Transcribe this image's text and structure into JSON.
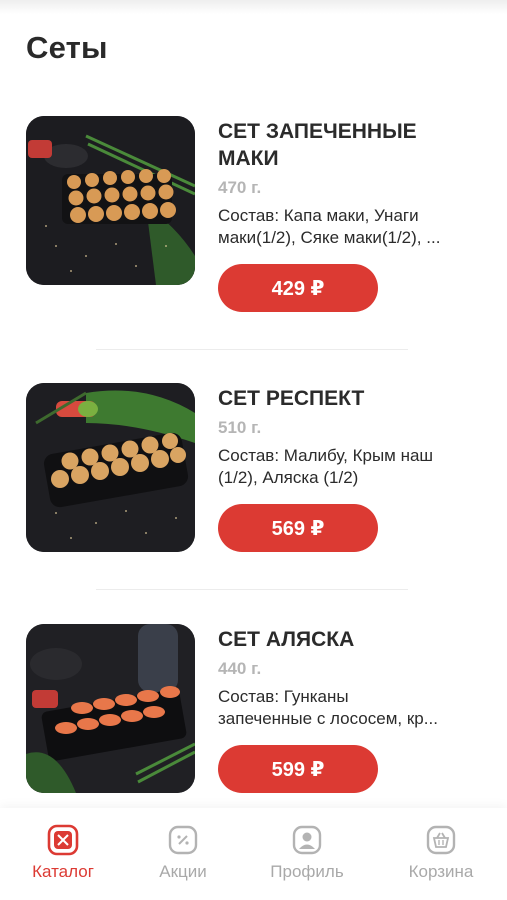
{
  "page": {
    "title": "Сеты"
  },
  "products": [
    {
      "name_line1": "СЕТ ЗАПЕЧЕННЫЕ",
      "name_line2": "МАКИ",
      "weight": "470 г.",
      "desc_line1": "Состав: Капа маки, Унаги",
      "desc_line2": "маки(1/2), Сяке маки(1/2), ...",
      "price": "429 ₽"
    },
    {
      "name_line1": "СЕТ РЕСПЕКТ",
      "name_line2": "",
      "weight": "510 г.",
      "desc_line1": "Состав: Малибу, Крым наш",
      "desc_line2": "(1/2), Аляска (1/2)",
      "price": "569 ₽"
    },
    {
      "name_line1": "СЕТ АЛЯСКА",
      "name_line2": "",
      "weight": "440 г.",
      "desc_line1": "Состав: Гунканы",
      "desc_line2": "запеченные с лососем, кр...",
      "price": "599 ₽"
    }
  ],
  "tabbar": {
    "items": [
      {
        "label": "Каталог",
        "icon": "catalog-icon",
        "active": true
      },
      {
        "label": "Акции",
        "icon": "promo-icon",
        "active": false
      },
      {
        "label": "Профиль",
        "icon": "profile-icon",
        "active": false
      },
      {
        "label": "Корзина",
        "icon": "basket-icon",
        "active": false
      }
    ]
  },
  "colors": {
    "accent": "#dc3a33",
    "inactive": "#a9a9a9",
    "text": "#2b2b2b",
    "muted": "#b5b5b5"
  }
}
